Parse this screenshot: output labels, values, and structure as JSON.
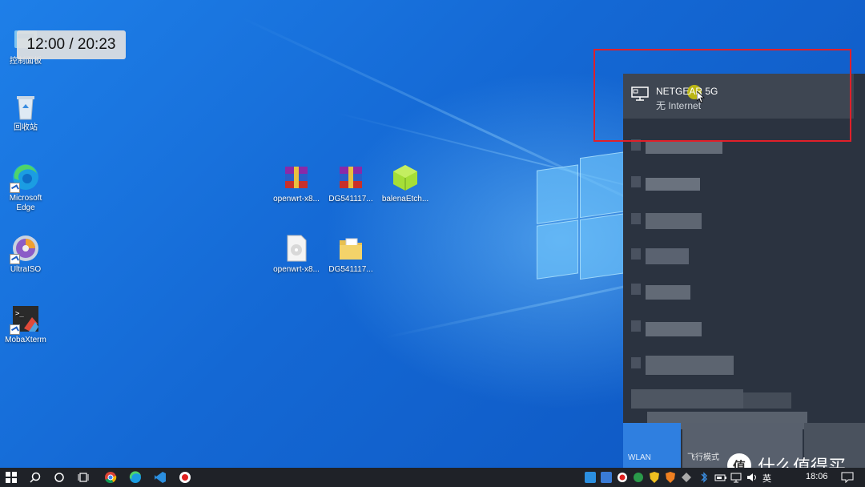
{
  "timer": {
    "text": "12:00 / 20:23"
  },
  "desktop_icons": [
    {
      "label": "控制面板",
      "icon": "control-panel-icon"
    },
    {
      "label": "回收站",
      "icon": "recycle-bin-icon"
    },
    {
      "label": "Microsoft Edge",
      "icon": "edge-icon"
    },
    {
      "label": "UltraISO",
      "icon": "ultraiso-icon"
    },
    {
      "label": "MobaXterm",
      "icon": "mobaxterm-icon"
    },
    {
      "label": "openwrt-x8...",
      "icon": "winrar-archive-icon"
    },
    {
      "label": "DG541117...",
      "icon": "winrar-archive-icon"
    },
    {
      "label": "balenaEtch...",
      "icon": "balena-etcher-icon"
    },
    {
      "label": "openwrt-x8...",
      "icon": "disk-image-file-icon"
    },
    {
      "label": "DG541117...",
      "icon": "folder-icon"
    }
  ],
  "network_flyout": {
    "selected": {
      "ssid": "NETGEAR 5G",
      "status": "无 Internet",
      "icon": "ethernet-monitor-icon"
    },
    "quick_actions": [
      {
        "label": "WLAN",
        "state": "on"
      },
      {
        "label": "飞行模式",
        "state": "off"
      }
    ]
  },
  "taskbar": {
    "icons": [
      "windows-start-icon",
      "search-icon",
      "cortana-icon",
      "task-view-icon",
      "chrome-icon",
      "edge-icon",
      "vscode-icon",
      "record-icon"
    ],
    "tray_icons": [
      "tray-app-icon",
      "tray-app-icon",
      "tray-record-icon",
      "tray-green-icon",
      "tray-shield-icon",
      "tray-orange-icon",
      "tray-gray-icon",
      "bluetooth-icon",
      "battery-icon",
      "network-icon",
      "volume-icon"
    ],
    "language": "英",
    "clock": "18:06"
  },
  "watermark": {
    "badge": "值",
    "text": "什么值得买"
  },
  "colors": {
    "highlight_box": "#e0202a",
    "flyout_bg": "#2b3340",
    "wlan_tile": "#2f7fe0"
  }
}
